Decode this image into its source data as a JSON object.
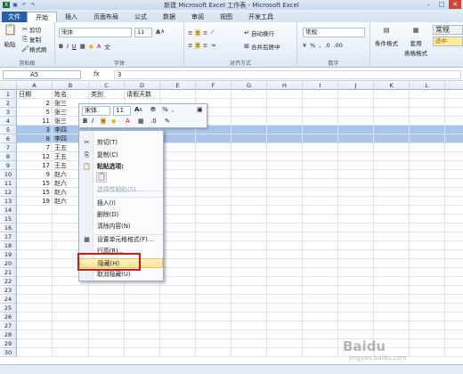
{
  "window": {
    "title": "新建 Microsoft Excel 工作表 - Microsoft Excel"
  },
  "tabs": [
    "文件",
    "开始",
    "插入",
    "页面布局",
    "公式",
    "数据",
    "审阅",
    "视图",
    "开发工具"
  ],
  "clipboard": {
    "cut": "剪切",
    "copy": "复制",
    "painter": "格式刷",
    "paste": "粘贴",
    "label": "剪贴板"
  },
  "font": {
    "name": "宋体",
    "size": "11",
    "label": "字体"
  },
  "align": {
    "wrap": "自动换行",
    "merge": "合并后居中",
    "label": "对齐方式"
  },
  "number": {
    "format": "常规",
    "pct": "%",
    "label": "数字"
  },
  "styles": {
    "cond": "条件格式",
    "table": "套用",
    "table2": "表格格式",
    "normal": "常规",
    "good": "适中"
  },
  "formulabar": {
    "name": "A5",
    "fx": "fx",
    "value": "3"
  },
  "columns": [
    "A",
    "B",
    "C",
    "D",
    "E",
    "F",
    "G",
    "H",
    "I",
    "J",
    "K",
    "L"
  ],
  "rows": [
    {
      "n": "1",
      "a": "日期",
      "b": "姓名",
      "c": "类别",
      "d": "请假天数"
    },
    {
      "n": "2",
      "a": "2",
      "b": "张三",
      "c": "",
      "d": ""
    },
    {
      "n": "3",
      "a": "5",
      "b": "张三",
      "c": "",
      "d": ""
    },
    {
      "n": "4",
      "a": "11",
      "b": "张三",
      "c": "",
      "d": ""
    },
    {
      "n": "5",
      "a": "3",
      "b": "李四",
      "c": "",
      "d": ""
    },
    {
      "n": "6",
      "a": "8",
      "b": "李四",
      "c": "",
      "d": ""
    },
    {
      "n": "7",
      "a": "7",
      "b": "王五",
      "c": "",
      "d": ""
    },
    {
      "n": "8",
      "a": "12",
      "b": "王五",
      "c": "",
      "d": ""
    },
    {
      "n": "9",
      "a": "17",
      "b": "王五",
      "c": "",
      "d": ""
    },
    {
      "n": "10",
      "a": "9",
      "b": "赵六",
      "c": "",
      "d": ""
    },
    {
      "n": "11",
      "a": "15",
      "b": "赵六",
      "c": "",
      "d": ""
    },
    {
      "n": "12",
      "a": "15",
      "b": "赵六",
      "c": "",
      "d": ""
    },
    {
      "n": "13",
      "a": "19",
      "b": "赵六",
      "c": "",
      "d": ""
    },
    {
      "n": "14"
    },
    {
      "n": "15"
    },
    {
      "n": "16"
    },
    {
      "n": "17"
    },
    {
      "n": "18"
    },
    {
      "n": "19"
    },
    {
      "n": "20"
    },
    {
      "n": "21"
    },
    {
      "n": "22"
    },
    {
      "n": "23"
    },
    {
      "n": "24"
    },
    {
      "n": "25"
    },
    {
      "n": "26"
    },
    {
      "n": "27"
    },
    {
      "n": "28"
    },
    {
      "n": "29"
    },
    {
      "n": "30"
    }
  ],
  "minitoolbar": {
    "font": "宋体",
    "size": "11",
    "pct": "%"
  },
  "context_menu": {
    "cut": "剪切(T)",
    "copy": "复制(C)",
    "paste_opts": "粘贴选项:",
    "paste_special": "选择性粘贴(S)...",
    "insert": "插入(I)",
    "delete": "删除(D)",
    "clear": "清除内容(N)",
    "format": "设置单元格格式(F)...",
    "rowheight": "行高(R)...",
    "hide": "隐藏(H)",
    "unhide": "取消隐藏(U)"
  },
  "watermark": {
    "brand": "Baidu",
    "sub": "jingyan.baidu.com"
  },
  "colors": {
    "selected_row": "#a9c6ea",
    "highlight": "#fff3c5",
    "red_box": "#d11b1b",
    "file_tab": "#2a5ea8"
  }
}
